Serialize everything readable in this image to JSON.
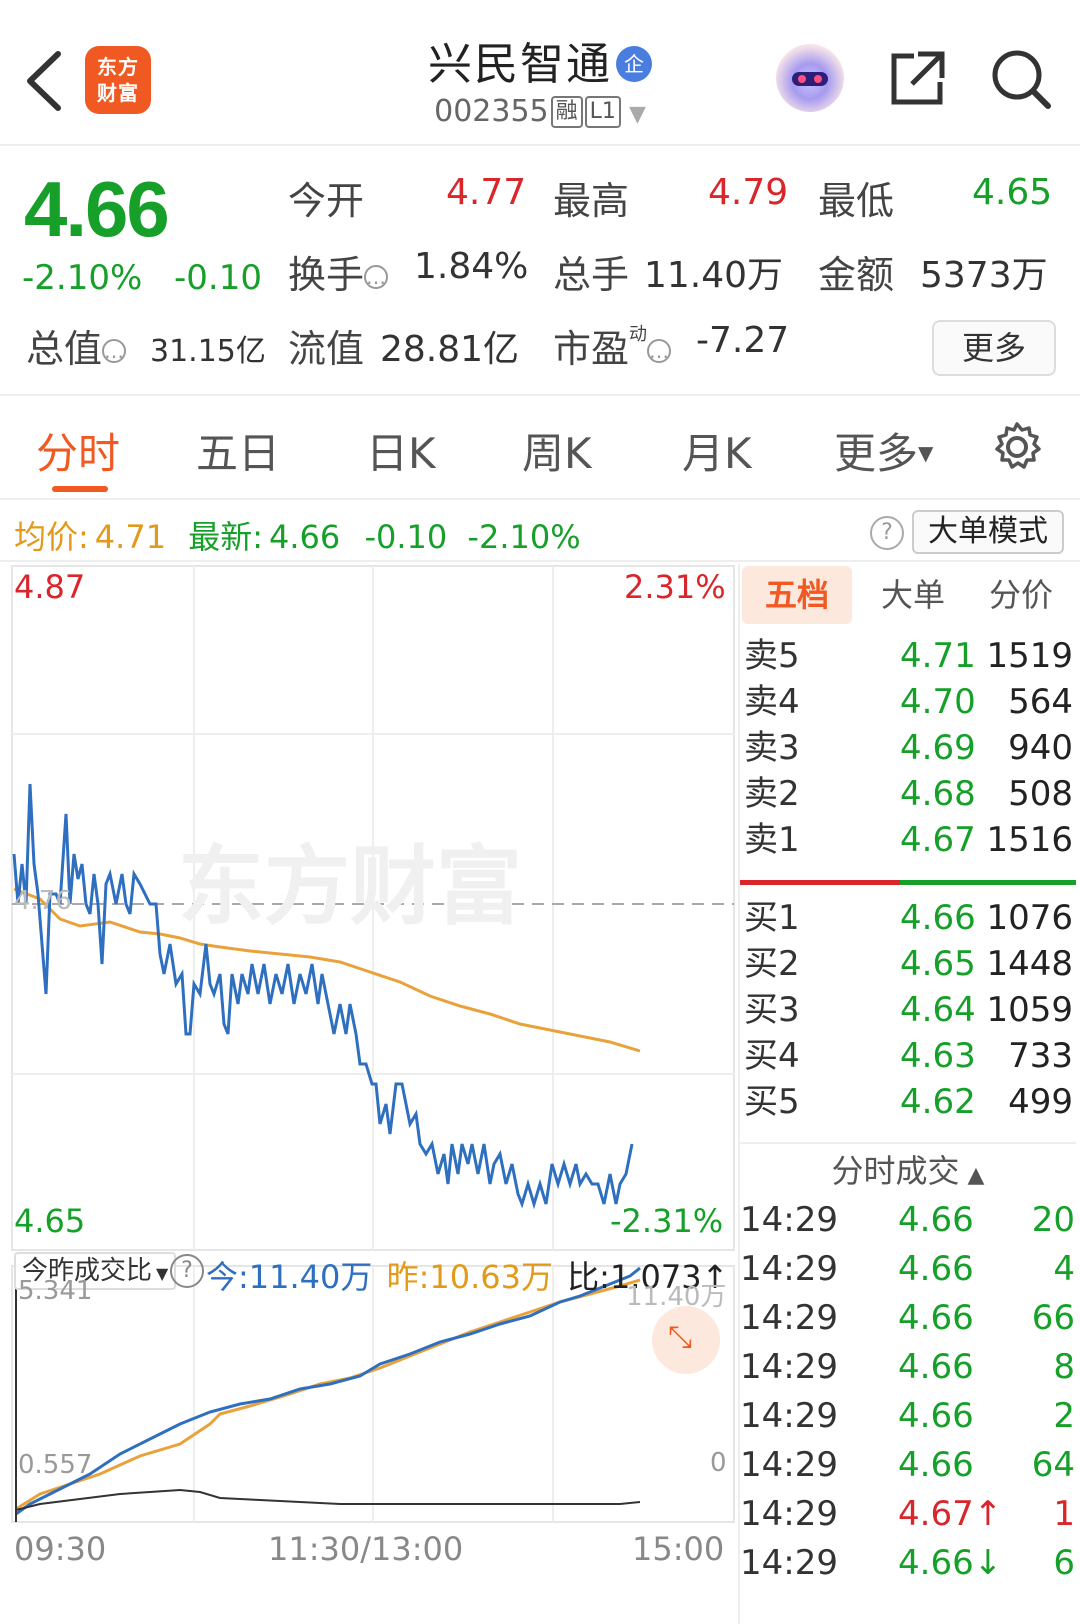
{
  "header": {
    "app_logo": "东方财富",
    "title": "兴民智通",
    "title_badge": "企",
    "code": "002355",
    "tag_rong": "融",
    "tag_level": "L1",
    "icons": [
      "back-icon",
      "mascot-icon",
      "share-icon",
      "search-icon"
    ]
  },
  "quote": {
    "price": "4.66",
    "change_pct": "-2.10%",
    "change": "-0.10",
    "open_label": "今开",
    "open": "4.77",
    "high_label": "最高",
    "high": "4.79",
    "low_label": "最低",
    "low": "4.65",
    "turnover_label": "换手",
    "turnover": "1.84%",
    "volume_label": "总手",
    "volume": "11.40万",
    "amount_label": "金额",
    "amount": "5373万",
    "mktcap_label": "总值",
    "mktcap": "31.15亿",
    "float_label": "流值",
    "float": "28.81亿",
    "pe_label": "市盈",
    "pe_sup": "动",
    "pe": "-7.27",
    "more_label": "更多"
  },
  "tabs": {
    "items": [
      "分时",
      "五日",
      "日K",
      "周K",
      "月K",
      "更多"
    ],
    "active": "分时"
  },
  "info_line": {
    "avg_label": "均价:",
    "avg": "4.71",
    "latest_label": "最新:",
    "latest": "4.66",
    "latest_chg": "-0.10",
    "latest_pct": "-2.10%",
    "mode_button": "大单模式",
    "help": "?"
  },
  "chart_labels": {
    "price_high": "4.87",
    "pct_high": "2.31%",
    "price_low": "4.65",
    "pct_low": "-2.31%",
    "ref_price": "4.76",
    "watermark": "东方财富",
    "vol_selector": "今昨成交比",
    "vol_today": "今:11.40万",
    "vol_yesterday": "昨:10.63万",
    "vol_ratio": "比:1.073",
    "vol_top_left": "5.341",
    "vol_top_right": "11.40万",
    "vol_bottom_left": "0.557",
    "vol_bottom_right": "0",
    "time_start": "09:30",
    "time_mid": "11:30/13:00",
    "time_end": "15:00"
  },
  "chart_data": {
    "type": "line",
    "ylim": [
      4.65,
      4.87
    ],
    "series": []
  },
  "order_book": {
    "tabs": [
      "五档",
      "大单",
      "分价"
    ],
    "active_tab": "五档",
    "asks": [
      {
        "label": "卖5",
        "price": "4.71",
        "vol": "1519"
      },
      {
        "label": "卖4",
        "price": "4.70",
        "vol": "564"
      },
      {
        "label": "卖3",
        "price": "4.69",
        "vol": "940"
      },
      {
        "label": "卖2",
        "price": "4.68",
        "vol": "508"
      },
      {
        "label": "卖1",
        "price": "4.67",
        "vol": "1516"
      }
    ],
    "bids": [
      {
        "label": "买1",
        "price": "4.66",
        "vol": "1076"
      },
      {
        "label": "买2",
        "price": "4.65",
        "vol": "1448"
      },
      {
        "label": "买3",
        "price": "4.64",
        "vol": "1059"
      },
      {
        "label": "买4",
        "price": "4.63",
        "vol": "733"
      },
      {
        "label": "买5",
        "price": "4.62",
        "vol": "499"
      }
    ]
  },
  "ticks": {
    "title": "分时成交",
    "rows": [
      {
        "time": "14:29",
        "price": "4.66",
        "vol": "20",
        "dir": ""
      },
      {
        "time": "14:29",
        "price": "4.66",
        "vol": "4",
        "dir": ""
      },
      {
        "time": "14:29",
        "price": "4.66",
        "vol": "66",
        "dir": ""
      },
      {
        "time": "14:29",
        "price": "4.66",
        "vol": "8",
        "dir": ""
      },
      {
        "time": "14:29",
        "price": "4.66",
        "vol": "2",
        "dir": ""
      },
      {
        "time": "14:29",
        "price": "4.66",
        "vol": "64",
        "dir": ""
      },
      {
        "time": "14:29",
        "price": "4.67",
        "vol": "1",
        "dir": "↑"
      },
      {
        "time": "14:29",
        "price": "4.66",
        "vol": "6",
        "dir": "↓"
      }
    ]
  },
  "colors": {
    "up": "#d8262b",
    "down": "#16a02a",
    "accent": "#f05a22",
    "avg_line": "#e9a23b",
    "price_line": "#2e6fbf"
  }
}
